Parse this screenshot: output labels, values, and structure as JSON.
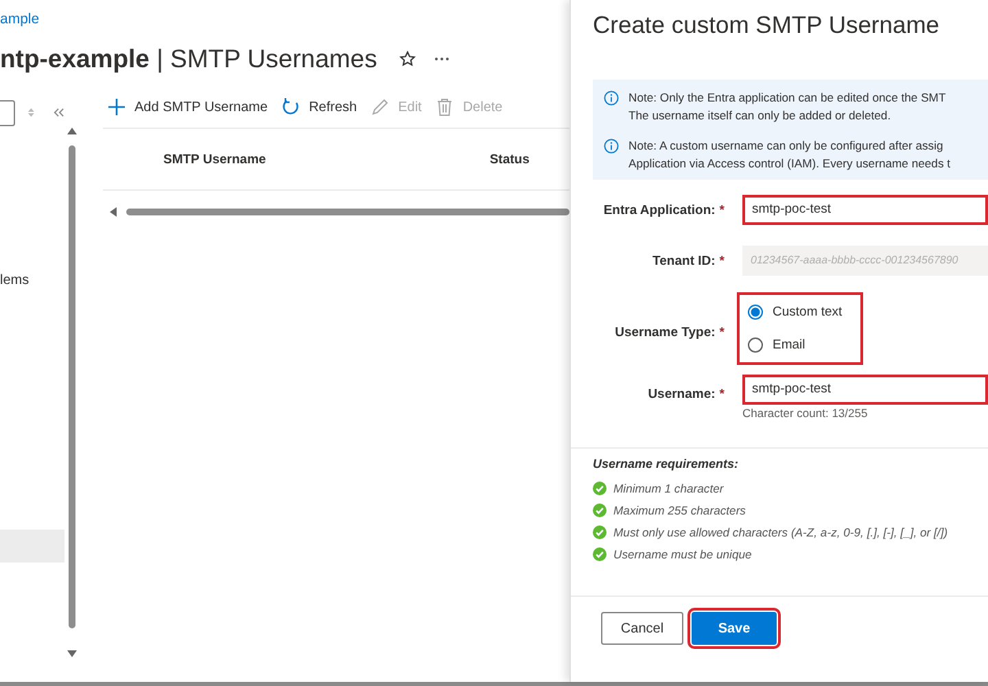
{
  "breadcrumb": "ample",
  "title": "**ntp-example** | SMTP Usernames",
  "sidebar": {
    "items": [
      {
        "label": "lems",
        "selected": false
      },
      {
        "selected": true
      }
    ]
  },
  "toolbar": [
    {
      "kind": "add",
      "label": "Add SMTP Username",
      "disabled": false
    },
    {
      "kind": "refresh",
      "label": "Refresh",
      "disabled": false
    },
    {
      "kind": "edit",
      "label": "Edit",
      "disabled": true
    },
    {
      "kind": "delete",
      "label": "Delete",
      "disabled": true
    }
  ],
  "table": {
    "columns": [
      "SMTP Username",
      "Status"
    ]
  },
  "panel": {
    "title": "Create custom SMTP Username",
    "notes": [
      {
        "lines": [
          "Note: Only the Entra application can be edited once the SMT",
          "The username itself can only be added or deleted."
        ]
      },
      {
        "lines": [
          "Note: A custom username can only be configured after assig",
          "Application via Access control (IAM). Every username needs t"
        ]
      }
    ],
    "fields": [
      {
        "kind": "text",
        "label": "Entra Application:",
        "required_mark": "*",
        "value": "smtp-poc-test",
        "disabled": false,
        "highlighted": true
      },
      {
        "kind": "text",
        "label": "Tenant ID:",
        "required_mark": "*",
        "value": "01234567-aaaa-bbbb-cccc-001234567890",
        "disabled": true,
        "highlighted": false
      },
      {
        "kind": "radio",
        "label": "Username Type:",
        "required_mark": "*",
        "highlighted": true,
        "options": [
          {
            "label": "Custom text",
            "selected": true
          },
          {
            "label": "Email",
            "selected": false
          }
        ]
      },
      {
        "kind": "text",
        "label": "Username:",
        "required_mark": "*",
        "value": "smtp-poc-test",
        "disabled": false,
        "highlighted": true,
        "hint": "Character count: 13/255"
      }
    ],
    "requirements": {
      "title": "Username requirements:",
      "items": [
        {
          "text": "Minimum 1 character",
          "met": true
        },
        {
          "text": "Maximum 255 characters",
          "met": true
        },
        {
          "text": "Must only use allowed characters (A-Z, a-z, 0-9, [.], [-], [_], or [/])",
          "met": true
        },
        {
          "text": "Username must be unique",
          "met": true
        }
      ]
    },
    "buttons": [
      {
        "kind": "secondary",
        "label": "Cancel",
        "highlighted": false
      },
      {
        "kind": "primary",
        "label": "Save",
        "highlighted": true
      }
    ]
  }
}
